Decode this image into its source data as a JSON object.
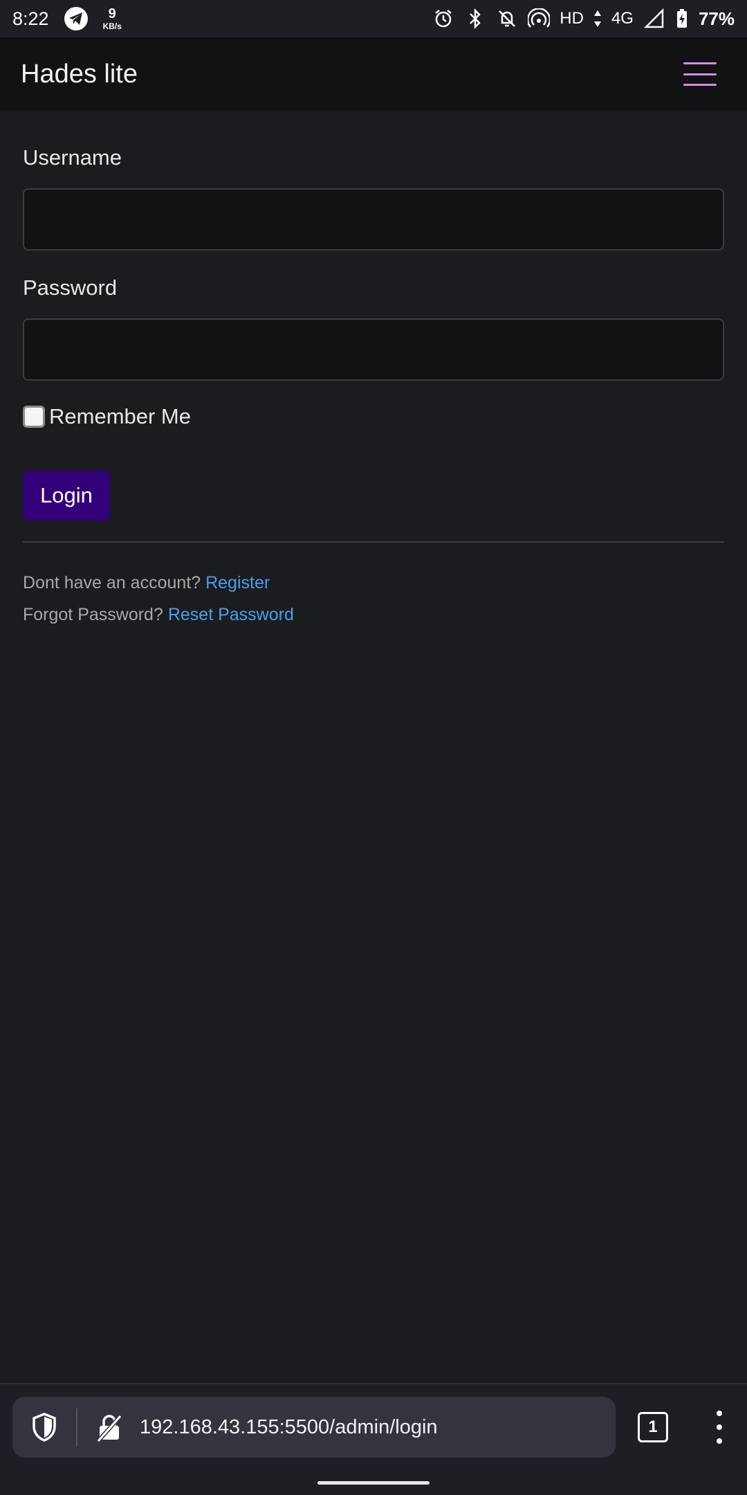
{
  "status_bar": {
    "time": "8:22",
    "net_speed_value": "9",
    "net_speed_unit": "KB/s",
    "hd_label": "HD",
    "network_label": "4G",
    "battery_percent": "77%"
  },
  "navbar": {
    "brand": "Hades lite"
  },
  "form": {
    "username_label": "Username",
    "username_value": "",
    "password_label": "Password",
    "password_value": "",
    "remember_label": "Remember Me",
    "remember_checked": false,
    "login_label": "Login"
  },
  "help": {
    "register_prompt": "Dont have an account?",
    "register_link": "Register",
    "forgot_prompt": "Forgot Password?",
    "reset_link": "Reset Password"
  },
  "browser": {
    "url": "192.168.43.155:5500/admin/login",
    "tab_count": "1"
  },
  "colors": {
    "background": "#1b1c1f",
    "navbar": "#111213",
    "accent_button": "#330079",
    "hamburger": "#d98ce0",
    "link": "#4a9fe9"
  }
}
